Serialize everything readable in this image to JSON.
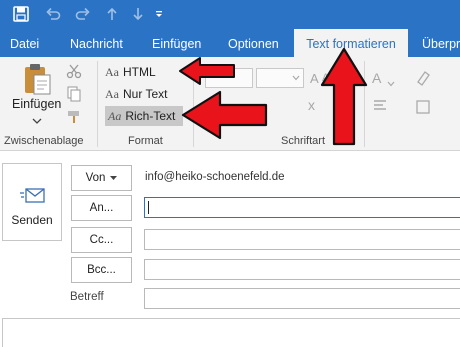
{
  "title_bar": {
    "accent": "#2b73c4",
    "quick_access_icons": [
      "save-icon",
      "undo-icon",
      "redo-icon",
      "arrow-up-icon",
      "arrow-down-icon",
      "customize-chevron-icon"
    ]
  },
  "tabs": [
    {
      "label": "Datei",
      "active": false
    },
    {
      "label": "Nachricht",
      "active": false
    },
    {
      "label": "Einfügen",
      "active": false
    },
    {
      "label": "Optionen",
      "active": false
    },
    {
      "label": "Text formatieren",
      "active": true
    },
    {
      "label": "Überpr",
      "active": false
    }
  ],
  "ribbon": {
    "clipboard": {
      "paste_label": "Einfügen",
      "group_label": "Zwischenablage"
    },
    "format": {
      "options": [
        {
          "glyph": "Aa",
          "label": "HTML"
        },
        {
          "glyph": "Aa",
          "label": "Nur Text"
        },
        {
          "glyph": "Aa",
          "label": "Rich-Text",
          "selected": true
        }
      ],
      "group_label": "Format"
    },
    "font": {
      "group_label": "Schriftart",
      "glyph_1": "A",
      "glyph_2": "A",
      "glyph_3": "x"
    }
  },
  "compose": {
    "send_label": "Senden",
    "from_button": "Von",
    "from_value": "info@heiko-schoenefeld.de",
    "to_button": "An...",
    "cc_button": "Cc...",
    "bcc_button": "Bcc...",
    "subject_label": "Betreff"
  },
  "annotations": {
    "arrow_color": "#e8131b"
  }
}
